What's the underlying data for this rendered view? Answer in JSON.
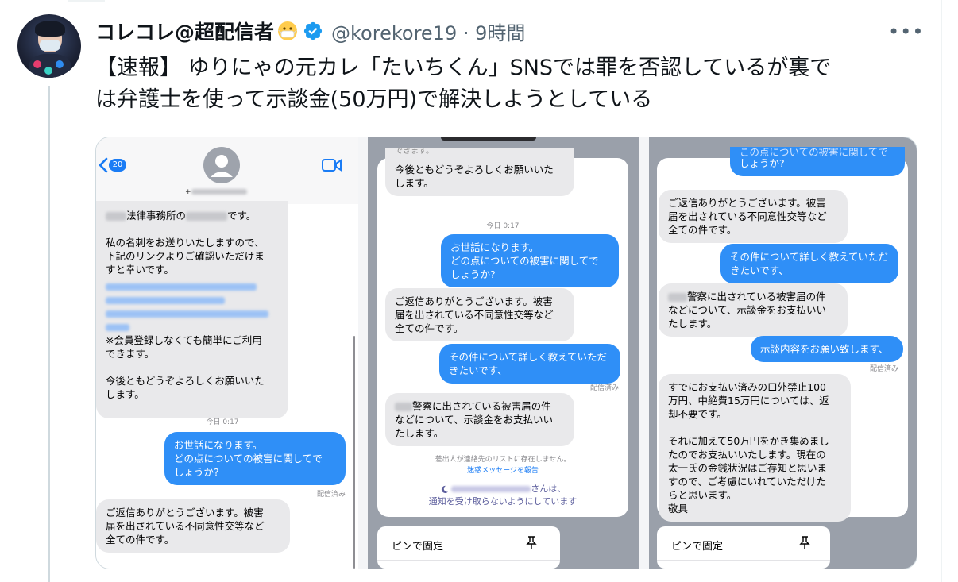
{
  "tweet": {
    "display_name": "コレコレ@超配信者",
    "handle_line": "@korekore19 · 9時間",
    "more_label": "•••",
    "text_line1": "【速報】 ゆりにゃの元カレ「たいちくん」SNSでは罪を否認しているが裏で",
    "text_line2": "は弁護士を使って示談金(50万円)で解決しようとしている"
  },
  "icons": {
    "avatar": "avatar-image",
    "badge": "verified-badge-icon",
    "emoji": "face-with-medical-mask-icon",
    "more": "more-icon",
    "back": "chevron-left-icon",
    "contact": "contact-avatar-icon",
    "video": "video-camera-icon",
    "moon": "moon-icon",
    "pin": "pin-icon"
  },
  "colors": {
    "verified": "#1d9bf0",
    "outgoing_bubble": "#2f8ff7",
    "incoming_bubble": "#e9e9eb"
  },
  "panel1": {
    "badge_count": "20",
    "plus": "+",
    "law_office_mid": "法律事務所の",
    "law_office_end": "です。",
    "msg_card_1": "私の名刺をお送りいたしますので、",
    "msg_card_2": "下記のリンクよりご確認いただけま",
    "msg_card_3": "すと幸いです。",
    "msg_member_1": "※会員登録しなくても簡単にご利用",
    "msg_member_2": "できます。",
    "msg_regards_1": "今後ともどうぞよろしくお願いいた",
    "msg_regards_2": "します。",
    "timestamp": "今日 0:17",
    "out1_1": "お世話になります。",
    "out1_2": "どの点についての被害に関してで",
    "out1_3": "しょうか?",
    "read": "配信済み",
    "reply_1": "ご返信ありがとうございます。被害",
    "reply_2": "届を出されている不同意性交等など",
    "reply_3": "全ての件です。"
  },
  "panel2": {
    "top_partial": "できます。",
    "regards_1": "今後ともどうぞよろしくお願いいた",
    "regards_2": "します。",
    "timestamp": "今日 0:17",
    "out1_1": "お世話になります。",
    "out1_2": "どの点についての被害に関してで",
    "out1_3": "しょうか?",
    "reply_1": "ご返信ありがとうございます。被害",
    "reply_2": "届を出されている不同意性交等など",
    "reply_3": "全ての件です。",
    "out2_1": "その件について詳しく教えていただ",
    "out2_2": "きたいです、",
    "read": "配信済み",
    "police_1": "警察に出されている被害届の件",
    "police_2": "などについて、示談金をお支払いい",
    "police_3": "たします。",
    "not_in_contacts": "差出人が連絡先のリストに存在しません。",
    "report_junk": "迷惑メッセージを報告",
    "silenced_1": "さんは、",
    "silenced_2": "通知を受け取らないようにしています",
    "pin_label": "ピンで固定"
  },
  "panel3": {
    "top_out_1": "この点についての被害に関してで",
    "top_out_2": "しょうか?",
    "reply_1": "ご返信ありがとうございます。被害",
    "reply_2": "届を出されている不同意性交等など",
    "reply_3": "全ての件です。",
    "out2_1": "その件について詳しく教えていただ",
    "out2_2": "きたいです、",
    "police_1": "警察に出されている被害届の件",
    "police_2": "などについて、示談金をお支払いい",
    "police_3": "たします。",
    "out3": "示談内容をお願い致します、",
    "read": "配信済み",
    "long_1": "すでにお支払い済みの口外禁止100",
    "long_2": "万円、中絶費15万円については、返",
    "long_3": "却不要です。",
    "long_4": "それに加えて50万円をかき集めまし",
    "long_5": "たのでお支払いいたします。現在の",
    "long_6": "太一氏の金銭状況はご存知と思いま",
    "long_7": "すので、ご考慮にいれていただけた",
    "long_8": "らと思います。",
    "long_9": "敬具",
    "pin_label": "ピンで固定"
  }
}
